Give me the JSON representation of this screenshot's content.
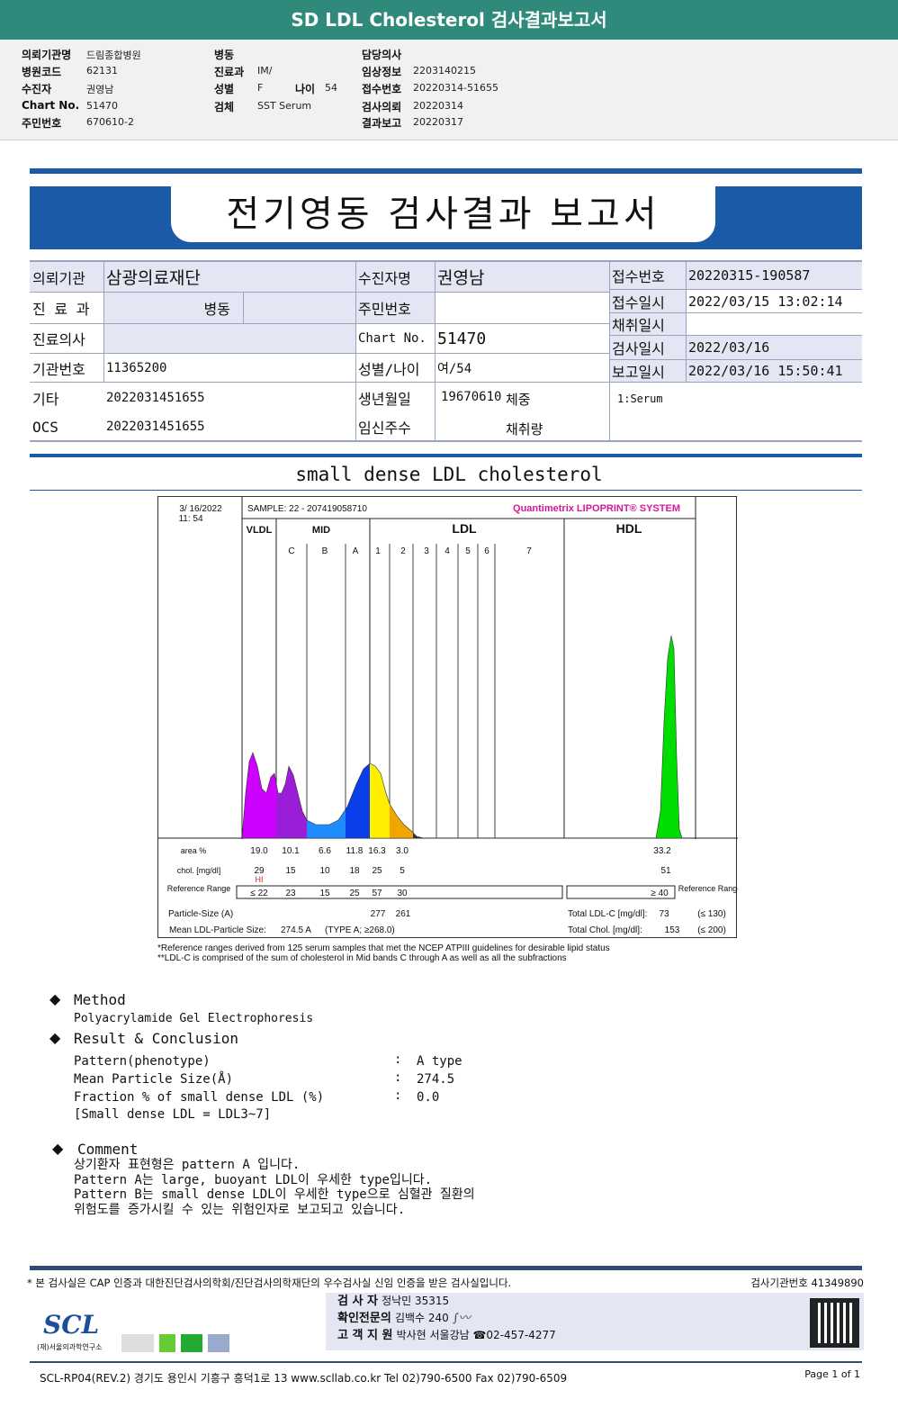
{
  "header": {
    "title": "SD LDL Cholesterol 검사결과보고서"
  },
  "info": [
    [
      {
        "label": "의뢰기관명",
        "value": "드림종합병원"
      },
      {
        "label": "병원코드",
        "value": "62131"
      },
      {
        "label": "수진자",
        "value": "권영남"
      },
      {
        "label": "Chart No.",
        "value": "51470"
      },
      {
        "label": "주민번호",
        "value": "670610-2"
      }
    ],
    [
      {
        "label": "병동",
        "value": ""
      },
      {
        "label": "진료과",
        "value": "IM/"
      },
      {
        "label": "성별",
        "value": "F"
      },
      {
        "label": "검체",
        "value": "SST Serum"
      }
    ],
    [
      {
        "label": "담당의사",
        "value": ""
      },
      {
        "label": "임상정보",
        "value": "2203140215"
      },
      {
        "label": "접수번호",
        "value": "20220314-51655"
      },
      {
        "label": "검사의뢰",
        "value": "20220314"
      },
      {
        "label": "결과보고",
        "value": "20220317"
      }
    ]
  ],
  "age": {
    "label": "나이",
    "value": "54"
  },
  "report": {
    "title": "전기영동 검사결과 보고서"
  },
  "table": {
    "inst_label": "의뢰기관",
    "inst": "삼광의료재단",
    "dept_label": "진 료 과",
    "ward_label": "병동",
    "doctor_label": "진료의사",
    "instno_label": "기관번호",
    "instno": "11365200",
    "etc_label": "기타",
    "etc": "2022031451655",
    "ocs_label": "OCS",
    "ocs": "2022031451655",
    "name_label": "수진자명",
    "name": "권영남",
    "ssn_label": "주민번호",
    "ssn": "",
    "chart_label": "Chart No.",
    "chart": "51470",
    "sexage_label": "성별/나이",
    "sexage": "여/54",
    "birth_label": "생년월일",
    "birth": "19670610",
    "weight_label": "체중",
    "preg_label": "임신주수",
    "volume_label": "채취량",
    "recno_label": "접수번호",
    "recno": "20220315-190587",
    "recdt_label": "접수일시",
    "recdt": "2022/03/15 13:02:14",
    "coldt_label": "채취일시",
    "coldt": "",
    "testdt_label": "검사일시",
    "testdt": "2022/03/16",
    "repdt_label": "보고일시",
    "repdt": "2022/03/16 15:50:41",
    "specimen": "1:Serum"
  },
  "subtitle": "small dense LDL cholesterol",
  "chart_data": {
    "type": "densitometry",
    "datetime": "3/ 16/2022",
    "time": "11: 54",
    "sample": "SAMPLE:   22 - 207419058710",
    "brand": "Quantimetrix LIPOPRINT® SYSTEM",
    "groups": [
      "VLDL",
      "MID",
      "LDL",
      "HDL"
    ],
    "bands": [
      "C",
      "B",
      "A",
      "1",
      "2",
      "3",
      "4",
      "5",
      "6",
      "7"
    ],
    "colors": {
      "VLDL": "#cc00ff",
      "C": "#9a1ed8",
      "B": "#1e8cff",
      "A": "#0a3ee8",
      "1": "#ffee00",
      "2": "#f2a500",
      "HDL": "#00dd00"
    },
    "rows": {
      "area_label": "area %",
      "area": [
        "19.0",
        "10.1",
        "6.6",
        "11.8",
        "16.3",
        "3.0"
      ],
      "area_hdl": "33.2",
      "chol_label": "chol. [mg/dl]",
      "chol": [
        "29",
        "15",
        "10",
        "18",
        "25",
        "5"
      ],
      "chol_hdl": "51",
      "flag": "HI",
      "ref_label": "Reference Range",
      "ref": [
        "≤ 22",
        "23",
        "15",
        "25",
        "57",
        "30"
      ],
      "ref_hdl": "≥ 40",
      "ref_label_right": "Reference Range",
      "size_label": "Particle-Size (A)",
      "size": [
        "277",
        "261"
      ],
      "mean_label": "Mean LDL-Particle Size:",
      "mean": "274.5 A",
      "mean_type": "(TYPE A; ≥268.0)",
      "ldlc_label": "Total LDL-C [mg/dl]:",
      "ldlc": "73",
      "ldlc_ref": "(≤ 130)",
      "tc_label": "Total Chol. [mg/dl]:",
      "tc": "153",
      "tc_ref": "(≤ 200)"
    },
    "notes": [
      "*Reference ranges derived from 125 serum samples that met the NCEP ATPIII guidelines for desirable lipid status",
      "**LDL-C is comprised of the sum of cholesterol in Mid bands C through A as well as all the subfractions"
    ]
  },
  "method": {
    "title": "Method",
    "text": "Polyacrylamide Gel Electrophoresis"
  },
  "result": {
    "title": "Result & Conclusion",
    "items": [
      {
        "label": "Pattern(phenotype)",
        "value": "A type"
      },
      {
        "label": "Mean Particle Size(Å)",
        "value": "274.5"
      },
      {
        "label": "Fraction % of small dense LDL (%)",
        "value": "0.0"
      }
    ],
    "note": "[Small dense LDL = LDL3~7]"
  },
  "comment": {
    "title": "Comment",
    "lines": [
      "상기환자 표현형은 pattern A 입니다.",
      "Pattern A는 large, buoyant LDL이 우세한 type입니다.",
      "Pattern B는 small dense LDL이 우세한 type으로 심혈관 질환의",
      "위험도를 증가시킬 수 있는 위험인자로 보고되고 있습니다."
    ]
  },
  "footer": {
    "cert": "* 본 검사실은 CAP 인증과 대한진단검사의학회/진단검사의학재단의 우수검사실 신임 인증을 받은 검사실입니다.",
    "labno": "검사기관번호 41349890",
    "tester_label": "검   사   자",
    "tester": "정낙민 35315",
    "confirm_label": "확인전문의",
    "confirm": "김백수 240",
    "support_label": "고 객 지 원",
    "support": "박사현 서울강남 ☎02-457-4277",
    "logo": "SCL",
    "logo_sub": "(재)서울의과학연구소",
    "address": "SCL-RP04(REV.2)  경기도 용인시 기흥구 흥덕1로 13  www.scllab.co.kr   Tel 02)790-6500   Fax 02)790-6509",
    "page": "Page 1 of 1"
  }
}
